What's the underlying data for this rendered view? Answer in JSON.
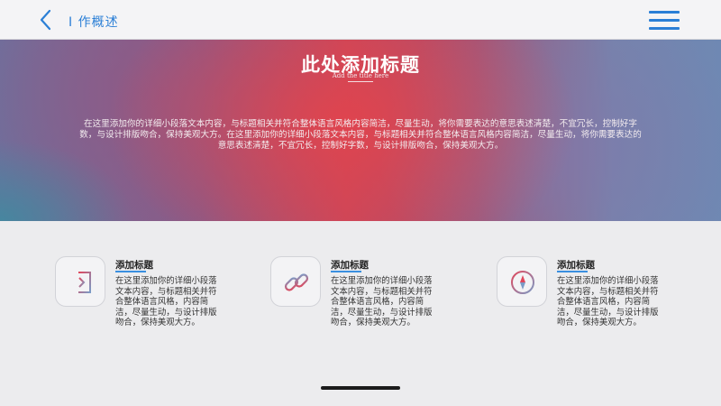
{
  "nav": {
    "title": "I 作概述",
    "back_icon": "chevron-left-icon",
    "menu_icon": "hamburger-menu-icon",
    "accent": "#2b7fd6"
  },
  "hero": {
    "title": "此处添加标题",
    "subtitle": "Add the title here",
    "paragraph": "在这里添加你的详细小段落文本内容，与标题相关并符合整体语言风格内容简洁，尽量生动，将你需要表达的意思表述清楚，不宜冗长，控制好字数，与设计排版吻合，保持美观大方。在这里添加你的详细小段落文本内容，与标题相关并符合整体语言风格内容简洁，尽量生动，将你需要表达的意思表述清楚，不宜冗长，控制好字数，与设计排版吻合，保持美观大方。"
  },
  "features": [
    {
      "icon": "sign-in-icon",
      "title": "添加标题",
      "text": "在这里添加你的详细小段落文本内容，与标题相关并符合整体语言风格，内容简洁，尽量生动，与设计排版吻合，保持美观大方。"
    },
    {
      "icon": "link-icon",
      "title": "添加标题",
      "text": "在这里添加你的详细小段落文本内容，与标题相关并符合整体语言风格，内容简洁，尽量生动，与设计排版吻合，保持美观大方。"
    },
    {
      "icon": "compass-icon",
      "title": "添加标题",
      "text": "在这里添加你的详细小段落文本内容，与标题相关并符合整体语言风格，内容简洁，尽量生动，与设计排版吻合，保持美观大方。"
    }
  ],
  "colors": {
    "icon_gradient_start": "#e0475b",
    "icon_gradient_end": "#7b9bc6",
    "underline": "#3a8fe0"
  }
}
